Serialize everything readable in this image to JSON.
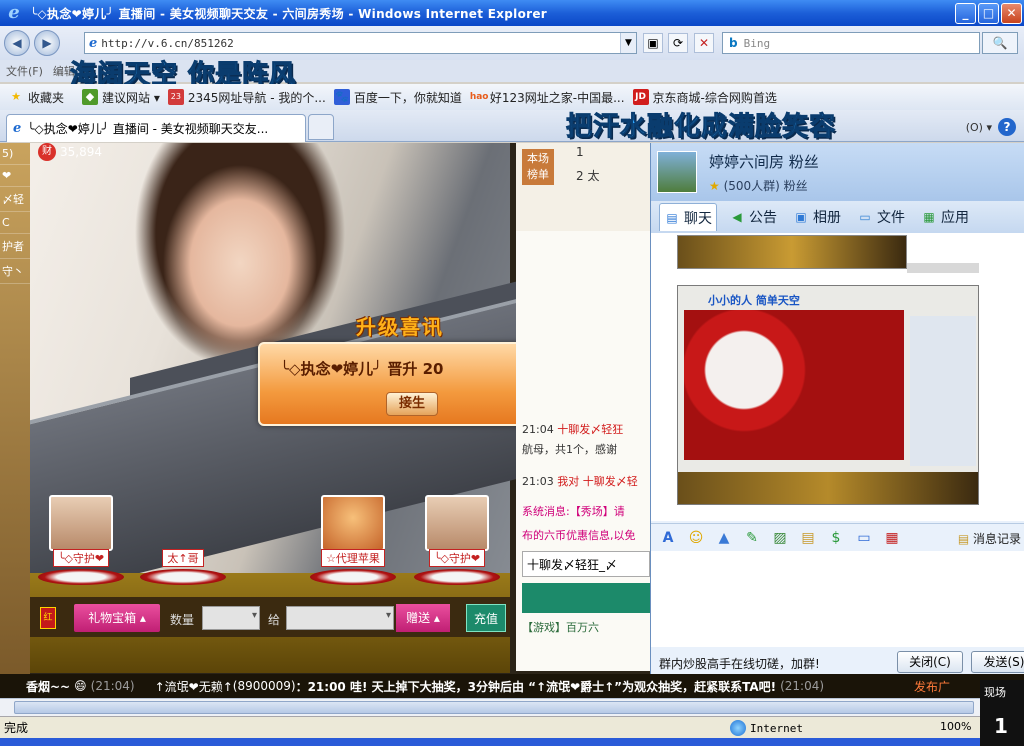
{
  "window": {
    "title": "╰◇执念❤婷儿╯ 直播间 - 美女视频聊天交友 - 六间房秀场 - Windows Internet Explorer",
    "buttons": {
      "minimize": "_",
      "maximize": "□",
      "close": "✕"
    }
  },
  "nav": {
    "back": "◀",
    "forward": "▶",
    "url": "http://v.6.cn/851262",
    "search_placeholder": "Bing",
    "search_button": "🔍"
  },
  "menu": {
    "items": [
      "文件(F)",
      "编辑(E)"
    ]
  },
  "overlay": {
    "line1": "海阔天空 你是阵风",
    "line2": "把汗水融化成满脸笑容"
  },
  "favorites": {
    "items": [
      {
        "label": "收藏夹",
        "icon": "star-icon",
        "color": "#f2b800"
      },
      {
        "label": "建议网站 ▾",
        "icon": "suggest-icon",
        "color": "#4f9a2a"
      },
      {
        "label": "2345网址导航 - 我的个...",
        "icon": "2345-icon",
        "color": "#d23b3b"
      },
      {
        "label": "百度一下，你就知道",
        "icon": "baidu-icon",
        "color": "#2f5ed8"
      },
      {
        "label": "好123网址之家-中国最...",
        "icon": "hao-icon",
        "color": "#e85d1c"
      },
      {
        "label": "京东商城-综合网购首选",
        "icon": "jd-icon",
        "color": "#d11d1d"
      }
    ]
  },
  "tabs": {
    "active": "╰◇执念❤婷儿╯ 直播间 - 美女视频聊天交友...",
    "right_label": "(O) ▾",
    "help": "?"
  },
  "room": {
    "left_strip": [
      "5)",
      "❤",
      "〆轻",
      "C",
      "护者",
      "守丶"
    ],
    "fans_count": "35,894",
    "upgrade_title": "升级喜讯",
    "upgrade_message": "╰◇执念❤婷儿╯  晋升 20",
    "upgrade_button": "接生",
    "guards": [
      {
        "name": "╰◇守护❤",
        "style": "photo"
      },
      {
        "name": "太↑哥",
        "style": "empty"
      },
      {
        "name": "☆代理苹果",
        "style": "cartoon"
      },
      {
        "name": "╰◇守护❤",
        "style": "photo"
      }
    ],
    "giftbar": {
      "red_packet": "红",
      "gift_box": "礼物宝箱 ▴",
      "quantity_label": "数量",
      "to_label": "给",
      "send": "赠送 ▴",
      "recharge": "充值"
    },
    "rank": {
      "tab": "本场榜单",
      "rows": [
        {
          "n": "1",
          "name": ""
        },
        {
          "n": "2",
          "name": "太"
        }
      ]
    },
    "chat": [
      {
        "time": "21:04",
        "text": "十聊发〆轻狂"
      },
      {
        "time": "",
        "text": "航母，共1个，感谢"
      },
      {
        "time": "21:03",
        "text": "我对 十聊发〆轻"
      },
      {
        "time": "",
        "text": "系统消息:【秀场】请"
      },
      {
        "time": "",
        "text": "布的六币优惠信息,以免"
      }
    ],
    "chat_input": "十聊发〆轻狂_〆",
    "game_line": "【游戏】百万六"
  },
  "qq": {
    "title": "婷婷六间房 粉丝",
    "subtitle": "(500人群) 粉丝",
    "tabs": [
      {
        "label": "聊天",
        "icon": "chat-icon"
      },
      {
        "label": "公告",
        "icon": "announce-icon"
      },
      {
        "label": "相册",
        "icon": "album-icon"
      },
      {
        "label": "文件",
        "icon": "folder-icon"
      },
      {
        "label": "应用",
        "icon": "apps-icon"
      }
    ],
    "shot_caption": "小小的人 简单天空",
    "toolbar_history": "消息记录",
    "ad": "群内炒股高手在线切磋，加群!",
    "close_button": "关闭(C)",
    "send_button": "发送(S)"
  },
  "ticker": {
    "user1": "香烟~~",
    "time1": "(21:04)",
    "user2": "↑流氓❤无赖↑",
    "id2": "(8900009)",
    "message": "：21:00 哇! 天上掉下大抽奖，3分钟后由 “↑流氓❤爵士↑”为观众抽奖，赶紧联系TA吧!",
    "time2": "(21:04)",
    "tail": "发布广"
  },
  "status": {
    "done": "完成",
    "zone": "Internet",
    "zoom": "100%",
    "popup_label": "现场",
    "popup_num": "1"
  }
}
